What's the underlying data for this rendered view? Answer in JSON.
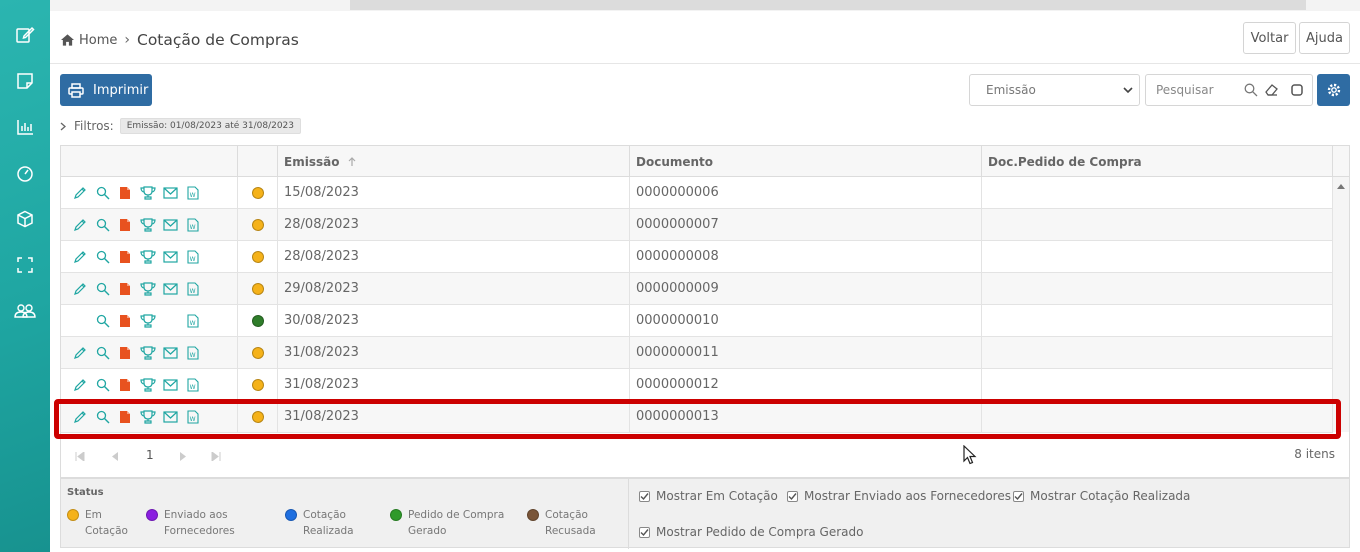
{
  "breadcrumb": {
    "home": "Home",
    "separator": "›",
    "title": "Cotação de Compras"
  },
  "header_buttons": {
    "back": "Voltar",
    "help": "Ajuda"
  },
  "toolbar": {
    "print_label": "Imprimir"
  },
  "date_select": {
    "value": "Emissão"
  },
  "search": {
    "placeholder": "Pesquisar"
  },
  "filters": {
    "label": "Filtros:",
    "chip": "Emissão: 01/08/2023 até 31/08/2023"
  },
  "grid": {
    "columns": {
      "emissao": "Emissão",
      "documento": "Documento",
      "doc_pedido": "Doc.Pedido de Compra"
    },
    "rows": [
      {
        "emissao": "15/08/2023",
        "documento": "0000000006",
        "doc_pedido": "",
        "status_color": "#f5b21a"
      },
      {
        "emissao": "28/08/2023",
        "documento": "0000000007",
        "doc_pedido": "",
        "status_color": "#f5b21a"
      },
      {
        "emissao": "28/08/2023",
        "documento": "0000000008",
        "doc_pedido": "",
        "status_color": "#f5b21a"
      },
      {
        "emissao": "29/08/2023",
        "documento": "0000000009",
        "doc_pedido": "",
        "status_color": "#f5b21a"
      },
      {
        "emissao": "30/08/2023",
        "documento": "0000000010",
        "doc_pedido": "",
        "status_color": "#2f7d2a"
      },
      {
        "emissao": "31/08/2023",
        "documento": "0000000011",
        "doc_pedido": "",
        "status_color": "#f5b21a"
      },
      {
        "emissao": "31/08/2023",
        "documento": "0000000012",
        "doc_pedido": "",
        "status_color": "#f5b21a"
      },
      {
        "emissao": "31/08/2023",
        "documento": "0000000013",
        "doc_pedido": "",
        "status_color": "#f5b21a"
      }
    ]
  },
  "pager": {
    "page": "1",
    "count": "8 itens"
  },
  "legend": {
    "title": "Status",
    "items": [
      {
        "line1": "Em",
        "line2": "Cotação",
        "color": "#f5b21a"
      },
      {
        "line1": "Enviado aos",
        "line2": "Fornecedores",
        "color": "#8a1fe0"
      },
      {
        "line1": "Cotação",
        "line2": "Realizada",
        "color": "#1f6fe0"
      },
      {
        "line1": "Pedido de Compra",
        "line2": "Gerado",
        "color": "#2f9a2a"
      },
      {
        "line1": "Cotação",
        "line2": "Recusada",
        "color": "#7a5538"
      }
    ]
  },
  "options": {
    "show_em_cotacao": "Mostrar Em Cotação",
    "show_enviado": "Mostrar Enviado aos Fornecedores",
    "show_realizada": "Mostrar Cotação Realizada",
    "show_pedido": "Mostrar Pedido de Compra Gerado"
  },
  "colors": {
    "sidebar": "#1fa6a2",
    "primary": "#2f6ca3",
    "accent_teal": "#1fa6a2",
    "pdf_red": "#e8521f",
    "highlight": "#cc0000"
  },
  "icons": [
    "edit-icon",
    "search-icon",
    "pdf-icon",
    "trophy-icon",
    "email-icon",
    "word-icon"
  ]
}
